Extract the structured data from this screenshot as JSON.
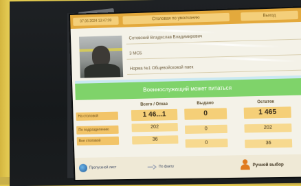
{
  "topbar": {
    "date_time": "07.06.2024 13:47:09",
    "mode": "Столовая по умолчанию",
    "exit": "Выход"
  },
  "person": {
    "name": "Сотовский Владислав Владимирович",
    "rank": "3 МСБ",
    "ration": "Норма №1 Общевойсковой паек"
  },
  "status_banner": "Военнослужащий может питаться",
  "table": {
    "headers": {
      "total": "Всего / Отказ",
      "issued": "Выдано",
      "remaining": "Остаток"
    },
    "rows": [
      {
        "label": "На столовой",
        "total": "1 46...1",
        "issued": "0",
        "remaining": "1 465"
      },
      {
        "label": "По подразделению",
        "total": "202",
        "issued": "0",
        "remaining": "202"
      },
      {
        "label": "Вне столовой",
        "total": "36",
        "issued": "0",
        "remaining": "36"
      }
    ]
  },
  "footer": {
    "left_button": "Пропускной лист",
    "middle_button": "По факту",
    "right_button": "Ручной выбор"
  },
  "colors": {
    "wall": "#e2c94e",
    "bezel": "#1a1d1f",
    "accent": "#e3a93c",
    "banner": "#7fd36a"
  }
}
